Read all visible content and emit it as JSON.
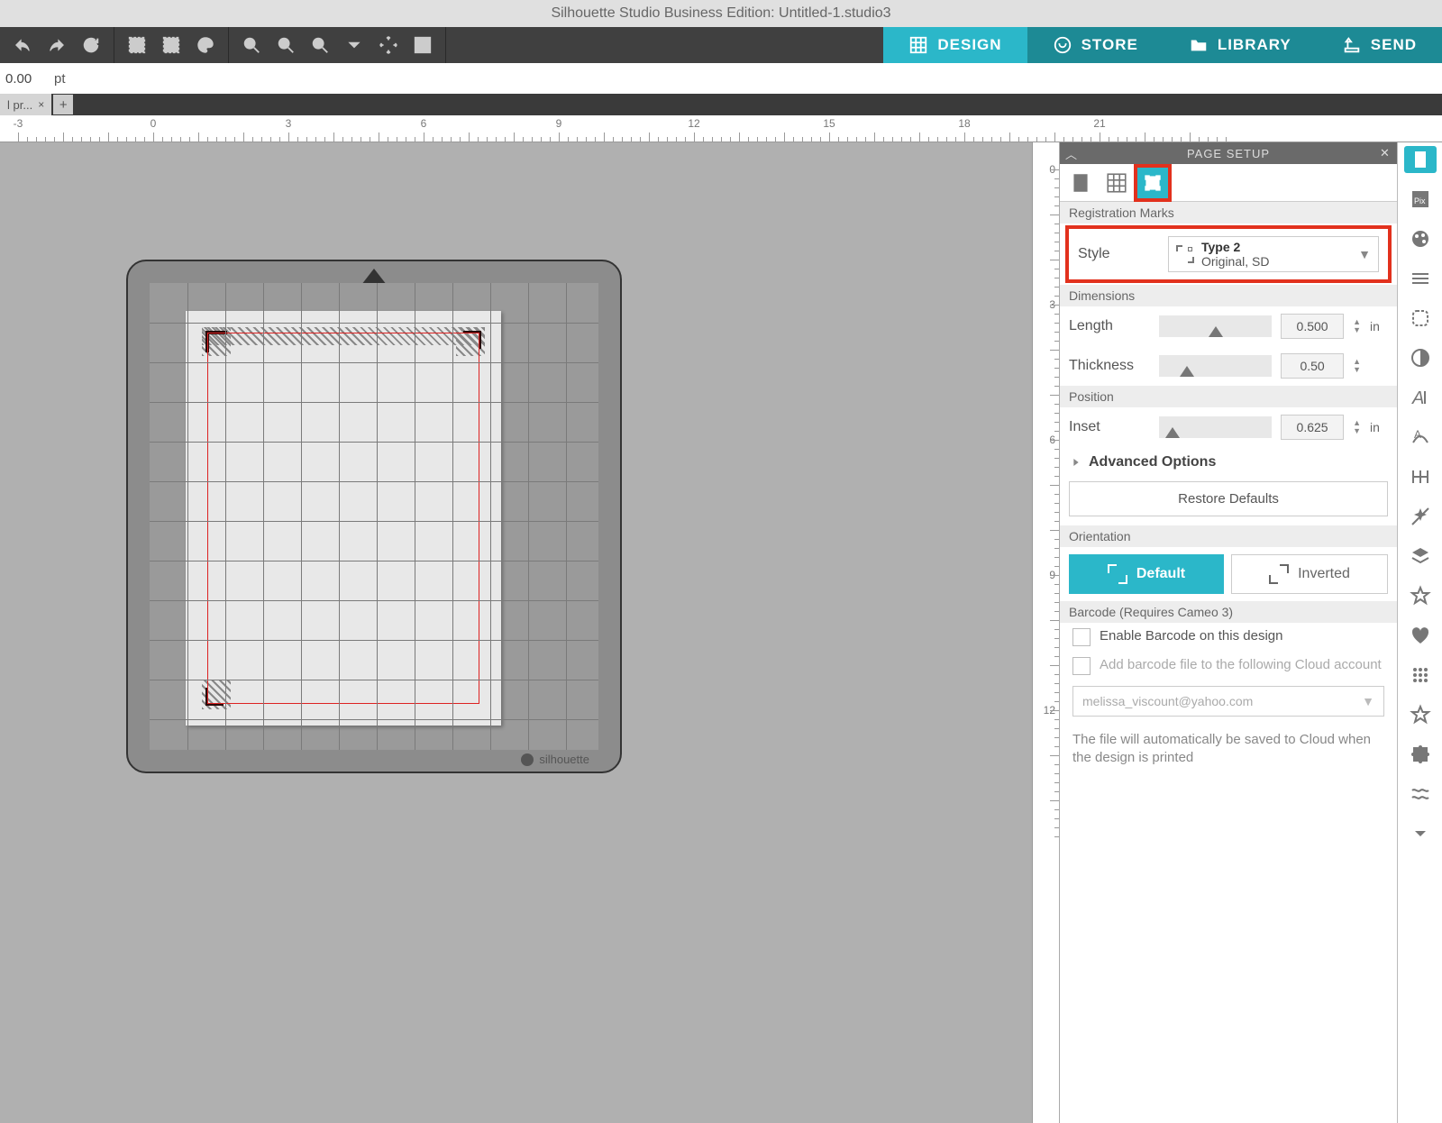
{
  "app_title": "Silhouette Studio Business Edition: Untitled-1.studio3",
  "main_tabs": {
    "design": "DESIGN",
    "store": "STORE",
    "library": "LIBRARY",
    "send": "SEND"
  },
  "sub_toolbar": {
    "value": "0.00",
    "unit": "pt"
  },
  "doc_tab": {
    "label": "l pr...",
    "close": "×",
    "add": "+"
  },
  "ruler_h": [
    "-3",
    "0",
    "3",
    "6",
    "9",
    "12",
    "15",
    "18",
    "21"
  ],
  "ruler_v": [
    "0",
    "3",
    "6",
    "9",
    "12"
  ],
  "panel": {
    "title": "PAGE SETUP",
    "section_reg": "Registration Marks",
    "style_label": "Style",
    "style_value_title": "Type 2",
    "style_value_sub": "Original, SD",
    "section_dim": "Dimensions",
    "length_label": "Length",
    "length_value": "0.500",
    "length_unit": "in",
    "thickness_label": "Thickness",
    "thickness_value": "0.50",
    "section_pos": "Position",
    "inset_label": "Inset",
    "inset_value": "0.625",
    "inset_unit": "in",
    "advanced": "Advanced Options",
    "restore": "Restore Defaults",
    "section_orient": "Orientation",
    "orient_default": "Default",
    "orient_inverted": "Inverted",
    "section_barcode": "Barcode (Requires Cameo 3)",
    "barcode_enable": "Enable Barcode on this design",
    "barcode_cloud": "Add barcode file to the following Cloud account",
    "account": "melissa_viscount@yahoo.com",
    "note": "The file will automatically be saved to Cloud when the design is printed"
  },
  "brand": "silhouette"
}
